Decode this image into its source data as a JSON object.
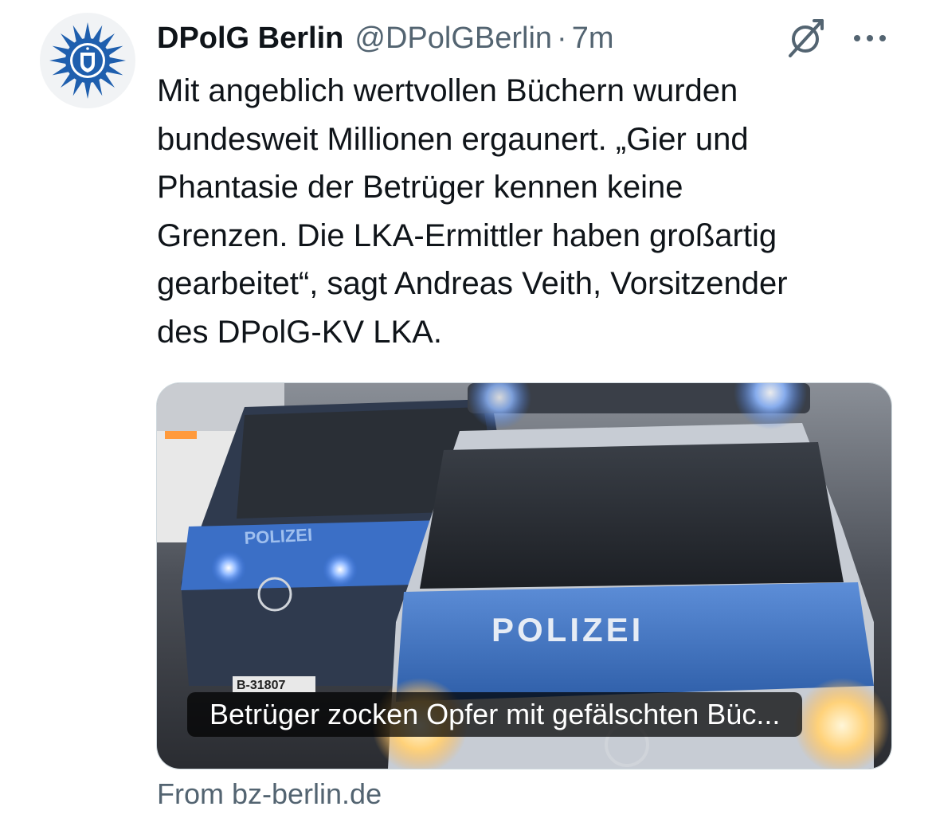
{
  "post": {
    "author_name": "DPolG Berlin",
    "author_handle": "@DPolGBerlin",
    "separator": "·",
    "time_ago": "7m",
    "avatar_icon": "police-star-logo-icon",
    "text_lines": [
      "Mit angeblich wertvollen Büchern wurden",
      "bundesweit Millionen ergaunert. „Gier und",
      "Phantasie der Betrüger kennen keine",
      "Grenzen. Die LKA-Ermittler haben großartig",
      "gearbeitet“, sagt Andreas Veith, Vorsitzender",
      "des DPolG-KV LKA."
    ]
  },
  "actions": {
    "grok_icon": "grok-icon",
    "more_icon": "more-icon"
  },
  "link_card": {
    "caption": "Betrüger zocken Opfer mit gefälschten Büc...",
    "image_text": {
      "front_vehicle_label": "POLIZEI",
      "rear_vehicle_label": "POLIZEI",
      "license_plate": "B-31807"
    },
    "source": "From bz-berlin.de"
  },
  "colors": {
    "text_primary": "#0f1419",
    "text_secondary": "#536471",
    "police_blue": "#3a6fc1",
    "logo_blue": "#1f5fae"
  }
}
